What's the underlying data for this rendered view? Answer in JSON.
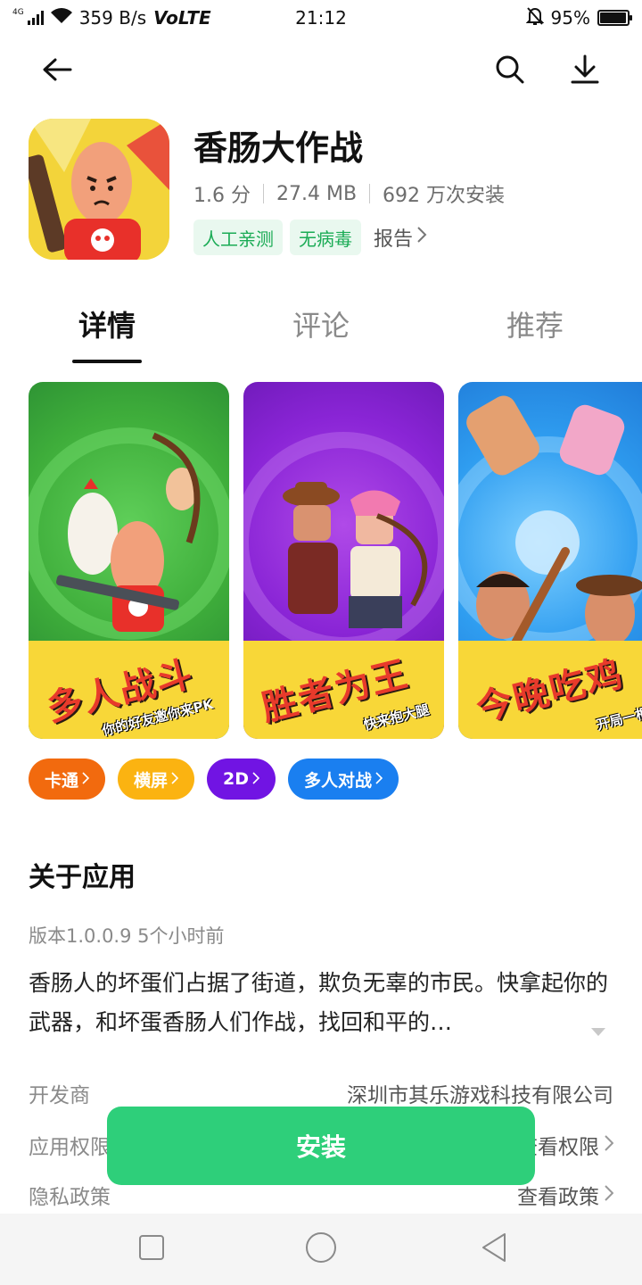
{
  "status_bar": {
    "network_tag": "4G",
    "speed": "359 B/s",
    "volte": "VoLTE",
    "time": "21:12",
    "battery_percent": "95%",
    "battery_level": 0.95
  },
  "header": {
    "back_icon": "arrow-left-icon",
    "search_icon": "search-icon",
    "download_icon": "download-icon"
  },
  "app": {
    "name": "香肠大作战",
    "rating": "1.6 分",
    "size": "27.4 MB",
    "installs": "692 万次安装",
    "badges": [
      "人工亲测",
      "无病毒"
    ],
    "report_label": "报告"
  },
  "tabs": [
    "详情",
    "评论",
    "推荐"
  ],
  "screenshots": [
    {
      "title": "多人战斗",
      "subtitle": "你的好友邀你来PK"
    },
    {
      "title": "胜者为王",
      "subtitle": "快来抱大腿"
    },
    {
      "title": "今晚吃鸡",
      "subtitle": "开局一根肠"
    }
  ],
  "genre_tags": [
    {
      "label": "卡通",
      "color": "#f26a0e"
    },
    {
      "label": "横屏",
      "color": "#fbb311"
    },
    {
      "label": "2D",
      "color": "#7114e3"
    },
    {
      "label": "多人对战",
      "color": "#1a7ff0"
    }
  ],
  "about": {
    "title": "关于应用",
    "version_line": "版本1.0.0.9  5个小时前",
    "description": "香肠人的坏蛋们占据了街道，欺负无辜的市民。快拿起你的武器，和坏蛋香肠人们作战，找回和平的…"
  },
  "info_rows": [
    {
      "label": "开发商",
      "value": "深圳市其乐游戏科技有限公司"
    },
    {
      "label": "应用权限",
      "value": "查看权限"
    },
    {
      "label": "隐私政策",
      "value": "查看政策"
    }
  ],
  "install_label": "安装"
}
